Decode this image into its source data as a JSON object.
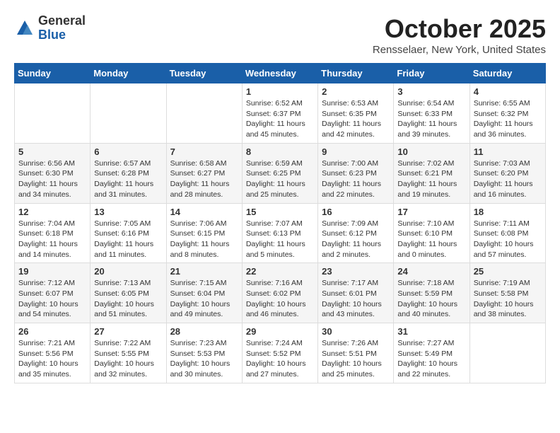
{
  "header": {
    "logo_general": "General",
    "logo_blue": "Blue",
    "month_title": "October 2025",
    "location": "Rensselaer, New York, United States"
  },
  "weekdays": [
    "Sunday",
    "Monday",
    "Tuesday",
    "Wednesday",
    "Thursday",
    "Friday",
    "Saturday"
  ],
  "weeks": [
    [
      {
        "day": "",
        "info": ""
      },
      {
        "day": "",
        "info": ""
      },
      {
        "day": "",
        "info": ""
      },
      {
        "day": "1",
        "info": "Sunrise: 6:52 AM\nSunset: 6:37 PM\nDaylight: 11 hours\nand 45 minutes."
      },
      {
        "day": "2",
        "info": "Sunrise: 6:53 AM\nSunset: 6:35 PM\nDaylight: 11 hours\nand 42 minutes."
      },
      {
        "day": "3",
        "info": "Sunrise: 6:54 AM\nSunset: 6:33 PM\nDaylight: 11 hours\nand 39 minutes."
      },
      {
        "day": "4",
        "info": "Sunrise: 6:55 AM\nSunset: 6:32 PM\nDaylight: 11 hours\nand 36 minutes."
      }
    ],
    [
      {
        "day": "5",
        "info": "Sunrise: 6:56 AM\nSunset: 6:30 PM\nDaylight: 11 hours\nand 34 minutes."
      },
      {
        "day": "6",
        "info": "Sunrise: 6:57 AM\nSunset: 6:28 PM\nDaylight: 11 hours\nand 31 minutes."
      },
      {
        "day": "7",
        "info": "Sunrise: 6:58 AM\nSunset: 6:27 PM\nDaylight: 11 hours\nand 28 minutes."
      },
      {
        "day": "8",
        "info": "Sunrise: 6:59 AM\nSunset: 6:25 PM\nDaylight: 11 hours\nand 25 minutes."
      },
      {
        "day": "9",
        "info": "Sunrise: 7:00 AM\nSunset: 6:23 PM\nDaylight: 11 hours\nand 22 minutes."
      },
      {
        "day": "10",
        "info": "Sunrise: 7:02 AM\nSunset: 6:21 PM\nDaylight: 11 hours\nand 19 minutes."
      },
      {
        "day": "11",
        "info": "Sunrise: 7:03 AM\nSunset: 6:20 PM\nDaylight: 11 hours\nand 16 minutes."
      }
    ],
    [
      {
        "day": "12",
        "info": "Sunrise: 7:04 AM\nSunset: 6:18 PM\nDaylight: 11 hours\nand 14 minutes."
      },
      {
        "day": "13",
        "info": "Sunrise: 7:05 AM\nSunset: 6:16 PM\nDaylight: 11 hours\nand 11 minutes."
      },
      {
        "day": "14",
        "info": "Sunrise: 7:06 AM\nSunset: 6:15 PM\nDaylight: 11 hours\nand 8 minutes."
      },
      {
        "day": "15",
        "info": "Sunrise: 7:07 AM\nSunset: 6:13 PM\nDaylight: 11 hours\nand 5 minutes."
      },
      {
        "day": "16",
        "info": "Sunrise: 7:09 AM\nSunset: 6:12 PM\nDaylight: 11 hours\nand 2 minutes."
      },
      {
        "day": "17",
        "info": "Sunrise: 7:10 AM\nSunset: 6:10 PM\nDaylight: 11 hours\nand 0 minutes."
      },
      {
        "day": "18",
        "info": "Sunrise: 7:11 AM\nSunset: 6:08 PM\nDaylight: 10 hours\nand 57 minutes."
      }
    ],
    [
      {
        "day": "19",
        "info": "Sunrise: 7:12 AM\nSunset: 6:07 PM\nDaylight: 10 hours\nand 54 minutes."
      },
      {
        "day": "20",
        "info": "Sunrise: 7:13 AM\nSunset: 6:05 PM\nDaylight: 10 hours\nand 51 minutes."
      },
      {
        "day": "21",
        "info": "Sunrise: 7:15 AM\nSunset: 6:04 PM\nDaylight: 10 hours\nand 49 minutes."
      },
      {
        "day": "22",
        "info": "Sunrise: 7:16 AM\nSunset: 6:02 PM\nDaylight: 10 hours\nand 46 minutes."
      },
      {
        "day": "23",
        "info": "Sunrise: 7:17 AM\nSunset: 6:01 PM\nDaylight: 10 hours\nand 43 minutes."
      },
      {
        "day": "24",
        "info": "Sunrise: 7:18 AM\nSunset: 5:59 PM\nDaylight: 10 hours\nand 40 minutes."
      },
      {
        "day": "25",
        "info": "Sunrise: 7:19 AM\nSunset: 5:58 PM\nDaylight: 10 hours\nand 38 minutes."
      }
    ],
    [
      {
        "day": "26",
        "info": "Sunrise: 7:21 AM\nSunset: 5:56 PM\nDaylight: 10 hours\nand 35 minutes."
      },
      {
        "day": "27",
        "info": "Sunrise: 7:22 AM\nSunset: 5:55 PM\nDaylight: 10 hours\nand 32 minutes."
      },
      {
        "day": "28",
        "info": "Sunrise: 7:23 AM\nSunset: 5:53 PM\nDaylight: 10 hours\nand 30 minutes."
      },
      {
        "day": "29",
        "info": "Sunrise: 7:24 AM\nSunset: 5:52 PM\nDaylight: 10 hours\nand 27 minutes."
      },
      {
        "day": "30",
        "info": "Sunrise: 7:26 AM\nSunset: 5:51 PM\nDaylight: 10 hours\nand 25 minutes."
      },
      {
        "day": "31",
        "info": "Sunrise: 7:27 AM\nSunset: 5:49 PM\nDaylight: 10 hours\nand 22 minutes."
      },
      {
        "day": "",
        "info": ""
      }
    ]
  ]
}
